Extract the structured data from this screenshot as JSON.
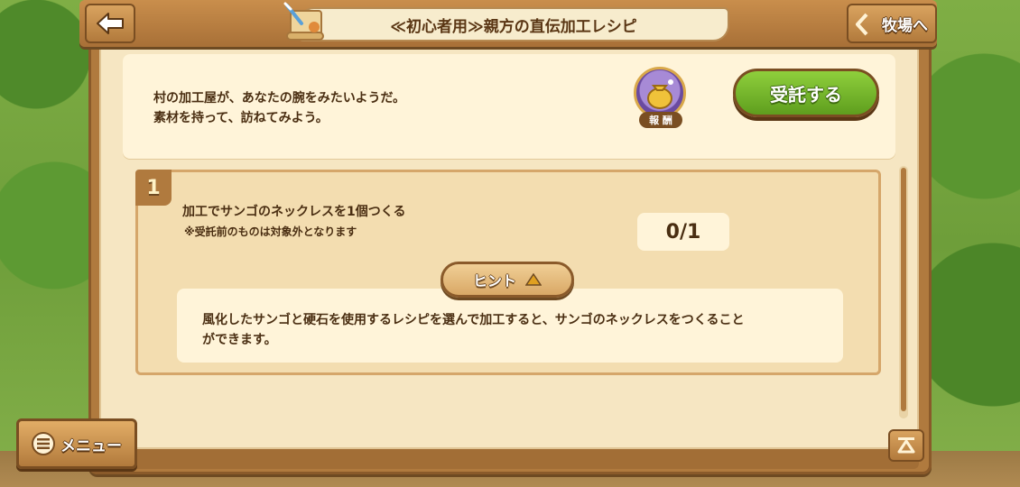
{
  "header": {
    "title": "≪初心者用≫親方の直伝加工レシピ",
    "back_icon": "back-arrow-icon",
    "farm_button_label": "牧場へ"
  },
  "info": {
    "description_lines": [
      "村の加工屋が、あなたの腕をみたいようだ。",
      "素材を持って、訪ねてみよう。"
    ],
    "reward_label": "報 酬",
    "reward_icon": "money-bag-icon",
    "accept_button_label": "受託する"
  },
  "task": {
    "number": "1",
    "title": "加工でサンゴのネックレスを1個つくる",
    "note": "※受託前のものは対象外となります",
    "progress": "0/1",
    "hint_button_label": "ヒント",
    "hint_lines": [
      "風化したサンゴと硬石を使用するレシピを選んで加工すると、サンゴのネックレスをつくること",
      "ができます。"
    ]
  },
  "menu": {
    "label": "メニュー"
  },
  "colors": {
    "wood": "#b07a3e",
    "parchment": "#f6e6c2",
    "accept_green": "#6fb12a",
    "text_brown": "#4a2e12"
  }
}
